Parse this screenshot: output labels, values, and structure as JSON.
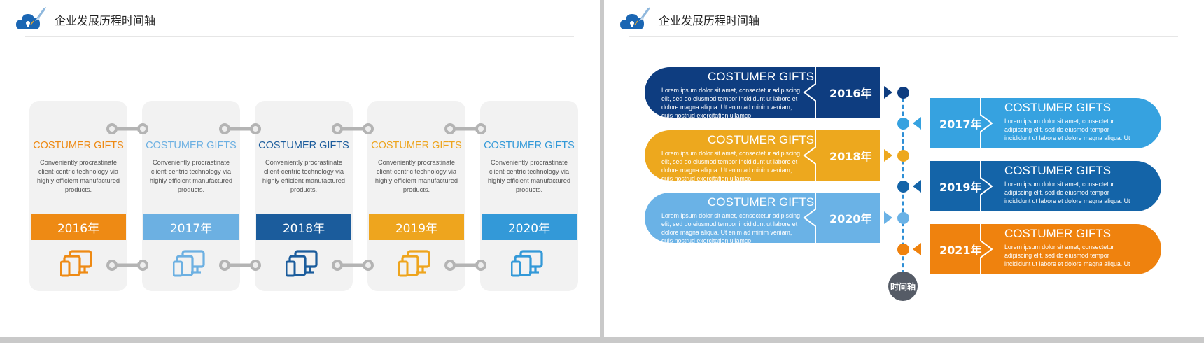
{
  "left_slide": {
    "title": "企业发展历程时间轴",
    "cards": [
      {
        "title": "COSTUMER GIFTS",
        "desc": "Conveniently procrastinate client-centric technology via highly efficient manufactured products.",
        "year": "2016年",
        "color": "#ee8a14",
        "icon": "devices-icon"
      },
      {
        "title": "COSTUMER GIFTS",
        "desc": "Conveniently procrastinate client-centric technology via highly efficient manufactured products.",
        "year": "2017年",
        "color": "#6cb0e2",
        "icon": "devices-icon"
      },
      {
        "title": "COSTUMER GIFTS",
        "desc": "Conveniently procrastinate client-centric technology via highly efficient manufactured products.",
        "year": "2018年",
        "color": "#1b5c9c",
        "icon": "devices-icon"
      },
      {
        "title": "COSTUMER GIFTS",
        "desc": "Conveniently procrastinate client-centric technology via highly efficient manufactured products.",
        "year": "2019年",
        "color": "#eea51e",
        "icon": "devices-icon"
      },
      {
        "title": "COSTUMER GIFTS",
        "desc": "Conveniently procrastinate client-centric technology via highly efficient manufactured products.",
        "year": "2020年",
        "color": "#3399d8",
        "icon": "devices-icon"
      }
    ]
  },
  "right_slide": {
    "title": "企业发展历程时间轴",
    "axis_label": "时间轴",
    "entries": [
      {
        "side": "left",
        "title": "COSTUMER GIFTS",
        "desc": "Lorem ipsum dolor sit amet, consectetur adipiscing elit, sed do eiusmod tempor incididunt ut labore et dolore magna aliqua. Ut enim ad minim veniam, quis nostrud exercitation ullamco",
        "year": "2016年",
        "color": "#0e3d80"
      },
      {
        "side": "right",
        "title": "COSTUMER GIFTS",
        "desc": "Lorem ipsum dolor sit amet, consectetur adipiscing elit, sed do eiusmod tempor incididunt ut labore et dolore magna aliqua. Ut",
        "year": "2017年",
        "color": "#36a2e0"
      },
      {
        "side": "left",
        "title": "COSTUMER GIFTS",
        "desc": "Lorem ipsum dolor sit amet, consectetur adipiscing elit, sed do eiusmod tempor incididunt ut labore et dolore magna aliqua. Ut enim ad minim veniam, quis nostrud exercitation ullamco",
        "year": "2018年",
        "color": "#eda81e"
      },
      {
        "side": "right",
        "title": "COSTUMER GIFTS",
        "desc": "Lorem ipsum dolor sit amet, consectetur adipiscing elit, sed do eiusmod tempor incididunt ut labore et dolore magna aliqua. Ut",
        "year": "2019年",
        "color": "#1464a8"
      },
      {
        "side": "left",
        "title": "COSTUMER GIFTS",
        "desc": "Lorem ipsum dolor sit amet, consectetur adipiscing elit, sed do eiusmod tempor incididunt ut labore et dolore magna aliqua. Ut enim ad minim veniam, quis nostrud exercitation ullamco",
        "year": "2020年",
        "color": "#6ab2e6"
      },
      {
        "side": "right",
        "title": "COSTUMER GIFTS",
        "desc": "Lorem ipsum dolor sit amet, consectetur adipiscing elit, sed do eiusmod tempor incididunt ut labore et dolore magna aliqua. Ut",
        "year": "2021年",
        "color": "#ef820e"
      }
    ]
  },
  "colors": {
    "connector": "#b4b4b4",
    "axis": "#2e8fd6",
    "axis_end": "#555b66",
    "logo": "#1a66b3"
  }
}
